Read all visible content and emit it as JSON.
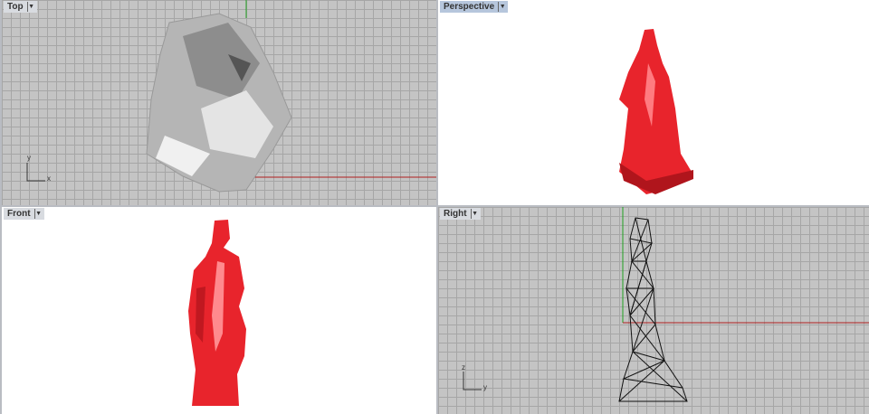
{
  "viewports": [
    {
      "name": "Top",
      "active": false,
      "axes": [
        "y",
        "x"
      ]
    },
    {
      "name": "Perspective",
      "active": true
    },
    {
      "name": "Front",
      "active": false
    },
    {
      "name": "Right",
      "active": false,
      "axes": [
        "z",
        "y"
      ]
    }
  ],
  "colors": {
    "model": "#e8242c",
    "grid": "#c4c4c4",
    "x_axis": "#b02020",
    "y_axis": "#20a020"
  }
}
